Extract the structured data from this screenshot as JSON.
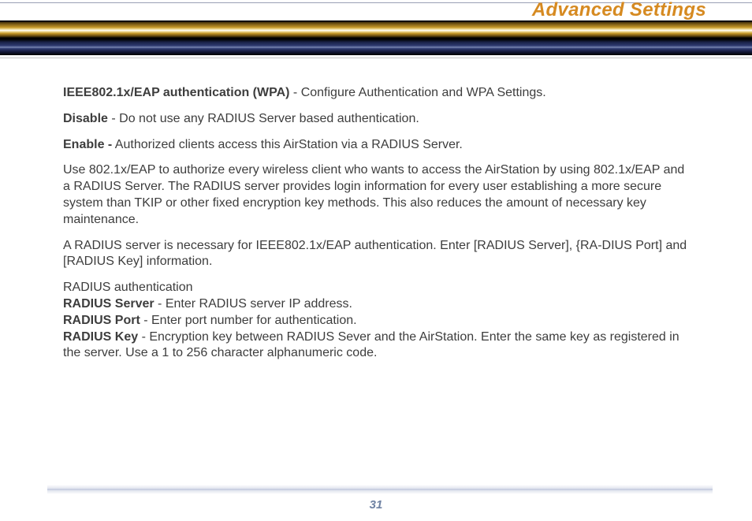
{
  "header": {
    "title": "Advanced Settings"
  },
  "body": {
    "p1_bold": "IEEE802.1x/EAP authentication (WPA)",
    "p1_rest": " - Configure Authentication and WPA Settings.",
    "p2_bold": "Disable",
    "p2_rest": " - Do not use any RADIUS Server based authentication.",
    "p3_bold": "Enable -",
    "p3_rest": " Authorized clients access this AirStation via a RADIUS Server.",
    "p4": "Use 802.1x/EAP to authorize every wireless client who wants to access the AirStation by using 802.1x/EAP and a RADIUS Server.  The RADIUS server provides login information for every user establishing a more secure system than TKIP or other fixed encryption key methods.  This also reduces the amount of necessary key maintenance.",
    "p5": "A RADIUS server is necessary for IEEE802.1x/EAP authentication. Enter [RADIUS Server], {RA-DIUS Port] and [RADIUS Key] information.",
    "p6_lead": "RADIUS authentication",
    "p6_s_bold": "RADIUS Server",
    "p6_s_rest": " - Enter RADIUS server IP address.",
    "p6_p_bold": "RADIUS Port",
    "p6_p_rest": " - Enter port number for authentication.",
    "p6_k_bold": "RADIUS Key",
    "p6_k_rest": " - Encryption key between RADIUS Sever and the AirStation. Enter the same key as registered in the server.  Use a 1 to 256 character alphanumeric code."
  },
  "footer": {
    "page_number": "31"
  }
}
